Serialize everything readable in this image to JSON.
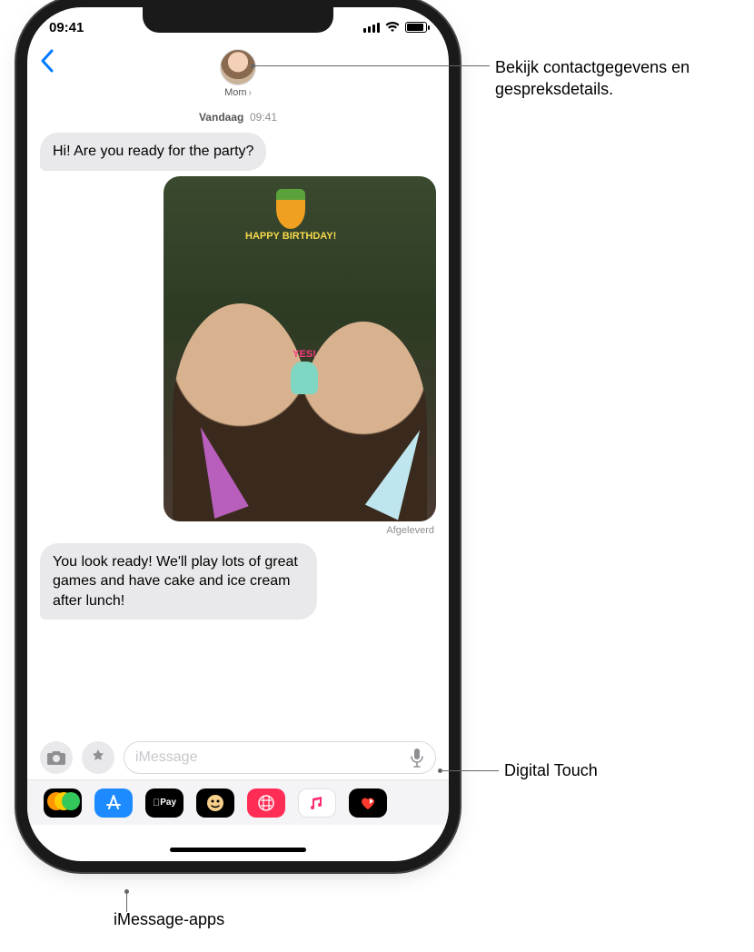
{
  "status": {
    "time": "09:41"
  },
  "header": {
    "contact_name": "Mom"
  },
  "timestamp": {
    "day": "Vandaag",
    "time": "09:41"
  },
  "messages": {
    "m1": "Hi! Are you ready for the party?",
    "m2": "You look ready! We'll play lots of great games and have cake and ice cream after lunch!",
    "delivered": "Afgeleverd",
    "sticker_hb": "HAPPY BIRTHDAY!",
    "sticker_yes": "YES!"
  },
  "compose": {
    "placeholder": "iMessage"
  },
  "apps": {
    "photos": "Photos",
    "store": "A",
    "pay": "Pay",
    "animoji": "Animoji",
    "sketch": "⊕",
    "music": "♫",
    "digital_touch": "Digital Touch"
  },
  "callouts": {
    "contact": "Bekijk contactgegevens en gespreksdetails.",
    "digital_touch": "Digital Touch",
    "imessage_apps": "iMessage-apps"
  }
}
